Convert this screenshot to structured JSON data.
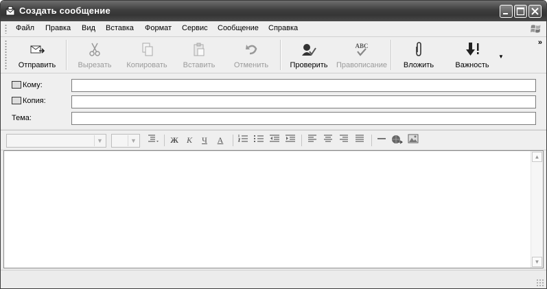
{
  "window": {
    "title": "Создать сообщение",
    "controls": [
      "minimize-icon",
      "maximize-icon",
      "close-icon"
    ]
  },
  "menu": {
    "items": [
      {
        "label": "Файл"
      },
      {
        "label": "Правка"
      },
      {
        "label": "Вид"
      },
      {
        "label": "Вставка"
      },
      {
        "label": "Формат"
      },
      {
        "label": "Сервис"
      },
      {
        "label": "Сообщение"
      },
      {
        "label": "Справка"
      }
    ]
  },
  "toolbar": {
    "send": "Отправить",
    "cut": "Вырезать",
    "copy": "Копировать",
    "paste": "Вставить",
    "undo": "Отменить",
    "check": "Проверить",
    "spelling": "Правописание",
    "spelling_icon_text": "ABC",
    "attach": "Вложить",
    "priority": "Важность",
    "overflow": "»"
  },
  "fields": {
    "to_label": "Кому:",
    "to_value": "",
    "cc_label": "Копия:",
    "cc_value": "",
    "subject_label": "Тема:",
    "subject_value": ""
  },
  "format": {
    "font_family": "",
    "font_size": "",
    "bold": "Ж",
    "italic": "К",
    "underline": "Ч",
    "font_color": "А"
  },
  "body": {
    "text": ""
  }
}
